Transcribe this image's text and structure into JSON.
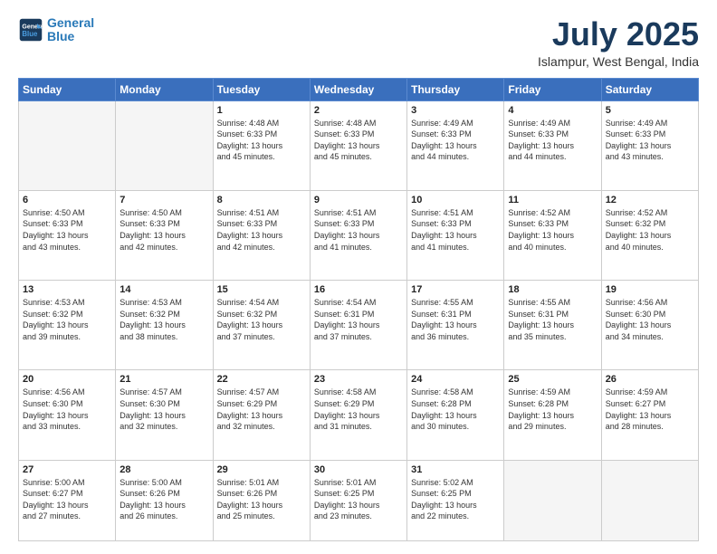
{
  "header": {
    "logo_line1": "General",
    "logo_line2": "Blue",
    "month_title": "July 2025",
    "subtitle": "Islampur, West Bengal, India"
  },
  "days_of_week": [
    "Sunday",
    "Monday",
    "Tuesday",
    "Wednesday",
    "Thursday",
    "Friday",
    "Saturday"
  ],
  "weeks": [
    [
      {
        "num": "",
        "detail": ""
      },
      {
        "num": "",
        "detail": ""
      },
      {
        "num": "1",
        "detail": "Sunrise: 4:48 AM\nSunset: 6:33 PM\nDaylight: 13 hours\nand 45 minutes."
      },
      {
        "num": "2",
        "detail": "Sunrise: 4:48 AM\nSunset: 6:33 PM\nDaylight: 13 hours\nand 45 minutes."
      },
      {
        "num": "3",
        "detail": "Sunrise: 4:49 AM\nSunset: 6:33 PM\nDaylight: 13 hours\nand 44 minutes."
      },
      {
        "num": "4",
        "detail": "Sunrise: 4:49 AM\nSunset: 6:33 PM\nDaylight: 13 hours\nand 44 minutes."
      },
      {
        "num": "5",
        "detail": "Sunrise: 4:49 AM\nSunset: 6:33 PM\nDaylight: 13 hours\nand 43 minutes."
      }
    ],
    [
      {
        "num": "6",
        "detail": "Sunrise: 4:50 AM\nSunset: 6:33 PM\nDaylight: 13 hours\nand 43 minutes."
      },
      {
        "num": "7",
        "detail": "Sunrise: 4:50 AM\nSunset: 6:33 PM\nDaylight: 13 hours\nand 42 minutes."
      },
      {
        "num": "8",
        "detail": "Sunrise: 4:51 AM\nSunset: 6:33 PM\nDaylight: 13 hours\nand 42 minutes."
      },
      {
        "num": "9",
        "detail": "Sunrise: 4:51 AM\nSunset: 6:33 PM\nDaylight: 13 hours\nand 41 minutes."
      },
      {
        "num": "10",
        "detail": "Sunrise: 4:51 AM\nSunset: 6:33 PM\nDaylight: 13 hours\nand 41 minutes."
      },
      {
        "num": "11",
        "detail": "Sunrise: 4:52 AM\nSunset: 6:33 PM\nDaylight: 13 hours\nand 40 minutes."
      },
      {
        "num": "12",
        "detail": "Sunrise: 4:52 AM\nSunset: 6:32 PM\nDaylight: 13 hours\nand 40 minutes."
      }
    ],
    [
      {
        "num": "13",
        "detail": "Sunrise: 4:53 AM\nSunset: 6:32 PM\nDaylight: 13 hours\nand 39 minutes."
      },
      {
        "num": "14",
        "detail": "Sunrise: 4:53 AM\nSunset: 6:32 PM\nDaylight: 13 hours\nand 38 minutes."
      },
      {
        "num": "15",
        "detail": "Sunrise: 4:54 AM\nSunset: 6:32 PM\nDaylight: 13 hours\nand 37 minutes."
      },
      {
        "num": "16",
        "detail": "Sunrise: 4:54 AM\nSunset: 6:31 PM\nDaylight: 13 hours\nand 37 minutes."
      },
      {
        "num": "17",
        "detail": "Sunrise: 4:55 AM\nSunset: 6:31 PM\nDaylight: 13 hours\nand 36 minutes."
      },
      {
        "num": "18",
        "detail": "Sunrise: 4:55 AM\nSunset: 6:31 PM\nDaylight: 13 hours\nand 35 minutes."
      },
      {
        "num": "19",
        "detail": "Sunrise: 4:56 AM\nSunset: 6:30 PM\nDaylight: 13 hours\nand 34 minutes."
      }
    ],
    [
      {
        "num": "20",
        "detail": "Sunrise: 4:56 AM\nSunset: 6:30 PM\nDaylight: 13 hours\nand 33 minutes."
      },
      {
        "num": "21",
        "detail": "Sunrise: 4:57 AM\nSunset: 6:30 PM\nDaylight: 13 hours\nand 32 minutes."
      },
      {
        "num": "22",
        "detail": "Sunrise: 4:57 AM\nSunset: 6:29 PM\nDaylight: 13 hours\nand 32 minutes."
      },
      {
        "num": "23",
        "detail": "Sunrise: 4:58 AM\nSunset: 6:29 PM\nDaylight: 13 hours\nand 31 minutes."
      },
      {
        "num": "24",
        "detail": "Sunrise: 4:58 AM\nSunset: 6:28 PM\nDaylight: 13 hours\nand 30 minutes."
      },
      {
        "num": "25",
        "detail": "Sunrise: 4:59 AM\nSunset: 6:28 PM\nDaylight: 13 hours\nand 29 minutes."
      },
      {
        "num": "26",
        "detail": "Sunrise: 4:59 AM\nSunset: 6:27 PM\nDaylight: 13 hours\nand 28 minutes."
      }
    ],
    [
      {
        "num": "27",
        "detail": "Sunrise: 5:00 AM\nSunset: 6:27 PM\nDaylight: 13 hours\nand 27 minutes."
      },
      {
        "num": "28",
        "detail": "Sunrise: 5:00 AM\nSunset: 6:26 PM\nDaylight: 13 hours\nand 26 minutes."
      },
      {
        "num": "29",
        "detail": "Sunrise: 5:01 AM\nSunset: 6:26 PM\nDaylight: 13 hours\nand 25 minutes."
      },
      {
        "num": "30",
        "detail": "Sunrise: 5:01 AM\nSunset: 6:25 PM\nDaylight: 13 hours\nand 23 minutes."
      },
      {
        "num": "31",
        "detail": "Sunrise: 5:02 AM\nSunset: 6:25 PM\nDaylight: 13 hours\nand 22 minutes."
      },
      {
        "num": "",
        "detail": ""
      },
      {
        "num": "",
        "detail": ""
      }
    ]
  ]
}
